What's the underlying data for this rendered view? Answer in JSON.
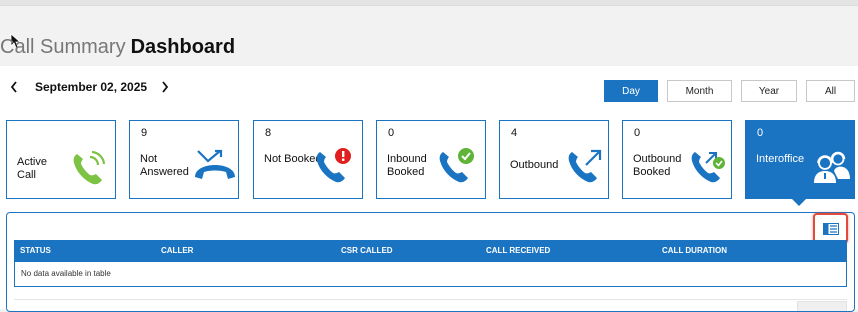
{
  "header": {
    "title_light": "Call Summary",
    "title_bold": "Dashboard"
  },
  "date_nav": {
    "date": "September 02, 2025",
    "prev_icon": "chevron-left-icon",
    "next_icon": "chevron-right-icon"
  },
  "periods": [
    {
      "label": "Day",
      "active": true
    },
    {
      "label": "Month",
      "active": false
    },
    {
      "label": "Year",
      "active": false
    },
    {
      "label": "All",
      "active": false
    }
  ],
  "cards": [
    {
      "count": "",
      "label": "Active Call",
      "icon": "phone-ringing-icon",
      "color": "#7cc243",
      "active": false
    },
    {
      "count": "9",
      "label": "Not Answered",
      "icon": "missed-call-icon",
      "color": "#1b74c2",
      "active": false
    },
    {
      "count": "8",
      "label": "Not Booked",
      "icon": "phone-alert-icon",
      "color": "#1b74c2",
      "badge_color": "#e02020",
      "active": false
    },
    {
      "count": "0",
      "label": "Inbound Booked",
      "icon": "phone-check-icon",
      "color": "#1b74c2",
      "badge_color": "#5fb336",
      "active": false
    },
    {
      "count": "4",
      "label": "Outbound",
      "icon": "phone-outgoing-icon",
      "color": "#1b74c2",
      "active": false
    },
    {
      "count": "0",
      "label": "Outbound Booked",
      "icon": "phone-outgoing-check-icon",
      "color": "#1b74c2",
      "badge_color": "#5fb336",
      "active": false
    },
    {
      "count": "0",
      "label": "Interoffice",
      "icon": "agents-icon",
      "color": "#ffffff",
      "active": true
    }
  ],
  "table": {
    "export_icon": "export-table-icon",
    "columns": [
      "STATUS",
      "CALLER",
      "CSR CALLED",
      "CALL RECEIVED",
      "CALL DURATION"
    ],
    "empty_text": "No data available in table"
  },
  "colors": {
    "accent": "#1b74c2",
    "highlight": "#e24a3b",
    "active_call": "#7cc243"
  }
}
